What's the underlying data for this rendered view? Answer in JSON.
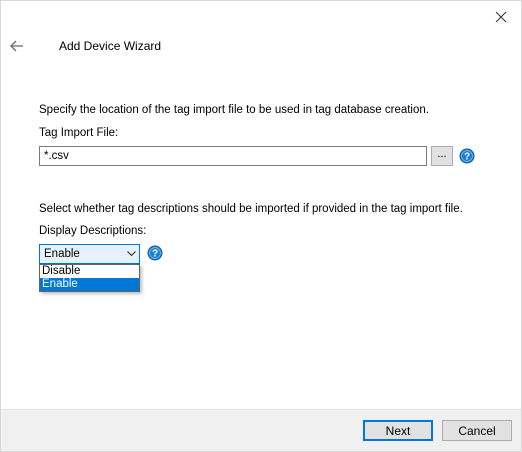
{
  "window": {
    "title": "Add Device Wizard"
  },
  "file_section": {
    "instruction": "Specify the location of the tag import file to be used in tag database creation.",
    "label": "Tag Import File:",
    "value": "*.csv",
    "browse_label": "..."
  },
  "description_section": {
    "instruction": "Select whether tag descriptions should be imported if provided in the tag import file.",
    "label": "Display Descriptions:",
    "selected": "Enable",
    "options": [
      "Disable",
      "Enable"
    ]
  },
  "footer": {
    "next_label": "Next",
    "cancel_label": "Cancel"
  },
  "colors": {
    "accent": "#0078d7",
    "help_icon": "#1c7fd1",
    "footer_bg": "#f0f0f0"
  }
}
